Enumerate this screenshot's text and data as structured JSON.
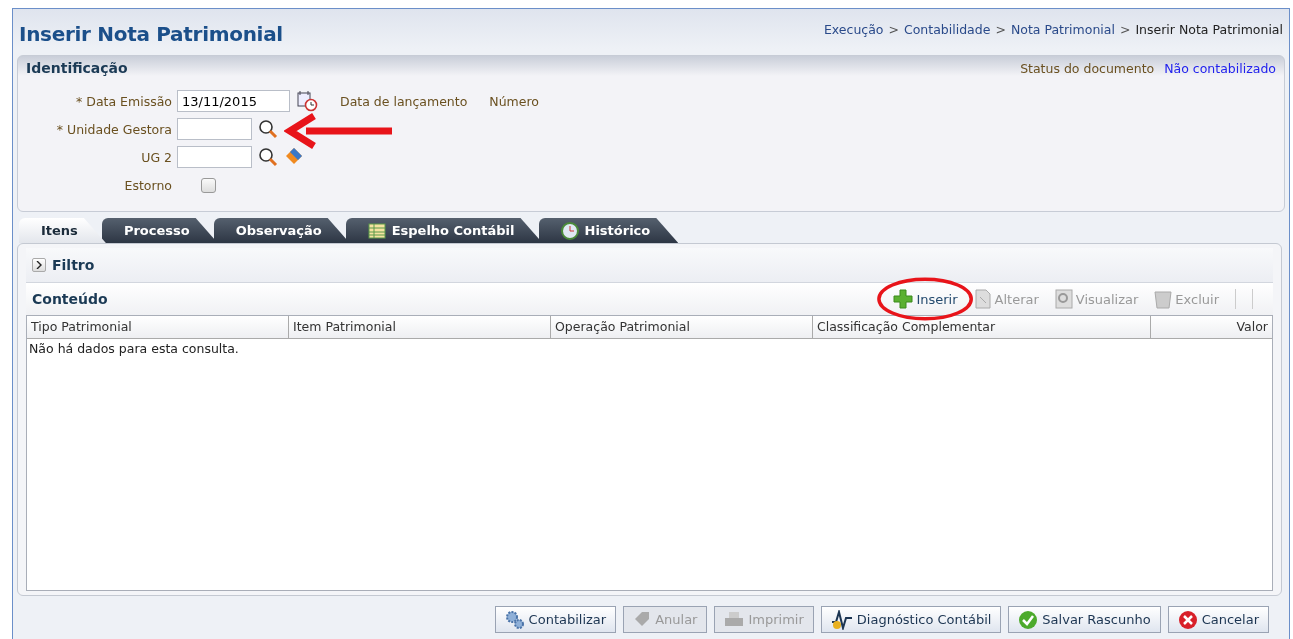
{
  "page": {
    "title": "Inserir Nota Patrimonial",
    "breadcrumb": [
      {
        "label": "Execução",
        "current": false
      },
      {
        "label": "Contabilidade",
        "current": false
      },
      {
        "label": "Nota Patrimonial",
        "current": false
      },
      {
        "label": "Inserir Nota Patrimonial",
        "current": true
      }
    ],
    "breadcrumb_separators": [
      ">",
      ">",
      ">"
    ]
  },
  "identification": {
    "title": "Identificação",
    "status_label": "Status do documento",
    "status_value": "Não contabilizado",
    "fields": [
      {
        "kind": "date",
        "label": "* Data Emissão",
        "value": "13/11/2015",
        "extras": [
          "Data de lançamento",
          "Número"
        ]
      },
      {
        "kind": "lookup",
        "label": "* Unidade Gestora",
        "clearable": false
      },
      {
        "kind": "lookup",
        "label": "UG 2",
        "clearable": true
      },
      {
        "kind": "checkbox",
        "label": "Estorno",
        "checked": false
      }
    ]
  },
  "tabs": [
    {
      "label": "Itens",
      "selected": true
    },
    {
      "label": "Processo",
      "selected": false
    },
    {
      "label": "Observação",
      "selected": false
    },
    {
      "label": "Espelho Contábil",
      "selected": false
    },
    {
      "label": "Histórico",
      "selected": false
    }
  ],
  "filter": {
    "label": "Filtro",
    "expanded": false
  },
  "content": {
    "title": "Conteúdo",
    "actions": [
      {
        "label": "Inserir",
        "disabled": false
      },
      {
        "label": "Alterar",
        "disabled": true
      },
      {
        "label": "Visualizar",
        "disabled": true
      },
      {
        "label": "Excluir",
        "disabled": true
      }
    ],
    "table": {
      "columns": [
        "Tipo Patrimonial",
        "Item Patrimonial",
        "Operação Patrimonial",
        "Classificação Complementar",
        "Valor"
      ],
      "empty_message": "Não há dados para esta consulta."
    }
  },
  "footer_buttons": [
    {
      "label": "Contabilizar",
      "disabled": false
    },
    {
      "label": "Anular",
      "disabled": true
    },
    {
      "label": "Imprimir",
      "disabled": true
    },
    {
      "label": "Diagnóstico Contábil",
      "disabled": false
    },
    {
      "label": "Salvar Rascunho",
      "disabled": false
    },
    {
      "label": "Cancelar",
      "disabled": false
    }
  ]
}
